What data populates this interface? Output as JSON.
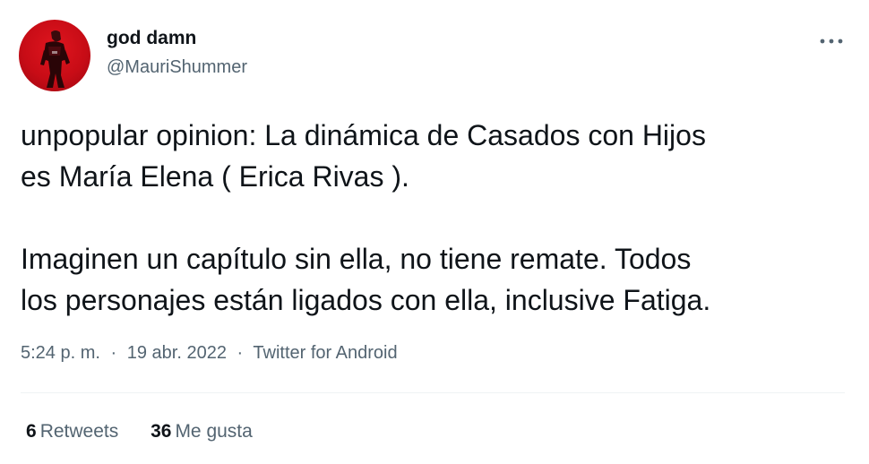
{
  "colors": {
    "text_primary": "#0f1419",
    "text_secondary": "#536471",
    "divider": "#eff3f4",
    "avatar_background": "#d3111b"
  },
  "author": {
    "display_name": "god damn",
    "handle": "@MauriShummer",
    "avatar_icon": "avatar-photo"
  },
  "menu": {
    "icon": "more-horizontal-icon"
  },
  "tweet": {
    "paragraphs": [
      [
        "unpopular opinion: La dinámica de Casados con Hijos",
        "es María Elena ( Erica Rivas )."
      ],
      [
        "Imaginen un capítulo sin ella, no tiene remate. Todos",
        "los personajes están ligados con ella, inclusive Fatiga."
      ]
    ]
  },
  "meta": {
    "time": "5:24 p. m.",
    "separator": "·",
    "date": "19 abr. 2022",
    "source": "Twitter for Android"
  },
  "stats": {
    "retweets_count": "6",
    "retweets_label": "Retweets",
    "likes_count": "36",
    "likes_label": "Me gusta"
  }
}
